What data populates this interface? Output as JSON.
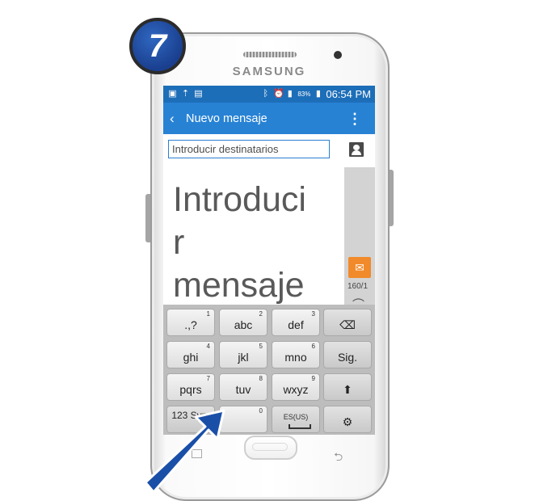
{
  "step": {
    "number": "7"
  },
  "device": {
    "brand": "SAMSUNG"
  },
  "status_bar": {
    "battery_percent": "83%",
    "time": "06:54 PM"
  },
  "app_bar": {
    "title": "Nuevo mensaje"
  },
  "recipient": {
    "placeholder": "Introducir destinatarios"
  },
  "message": {
    "placeholder_line1": "Introduci",
    "placeholder_line2": "r",
    "placeholder_line3": "mensaje"
  },
  "composer": {
    "counter": "160/1"
  },
  "keyboard": {
    "row1": [
      {
        "label": ".,?",
        "num": "1"
      },
      {
        "label": "abc",
        "num": "2"
      },
      {
        "label": "def",
        "num": "3"
      },
      {
        "label": "⌫",
        "num": ""
      }
    ],
    "row2": [
      {
        "label": "ghi",
        "num": "4"
      },
      {
        "label": "jkl",
        "num": "5"
      },
      {
        "label": "mno",
        "num": "6"
      },
      {
        "label": "Sig.",
        "num": ""
      }
    ],
    "row3": [
      {
        "label": "pqrs",
        "num": "7"
      },
      {
        "label": "tuv",
        "num": "8"
      },
      {
        "label": "wxyz",
        "num": "9"
      },
      {
        "label": "⬆",
        "num": ""
      }
    ],
    "row4": [
      {
        "label": "123 Sym",
        "num": ""
      },
      {
        "label": "",
        "num": "0"
      },
      {
        "label": "ES(US)",
        "num": ""
      },
      {
        "label": "⚙",
        "num": ""
      }
    ]
  },
  "colors": {
    "status_bar": "#1d6eb8",
    "app_bar": "#2782d4",
    "send_button": "#f18a2a",
    "arrow": "#1a4fa8"
  }
}
